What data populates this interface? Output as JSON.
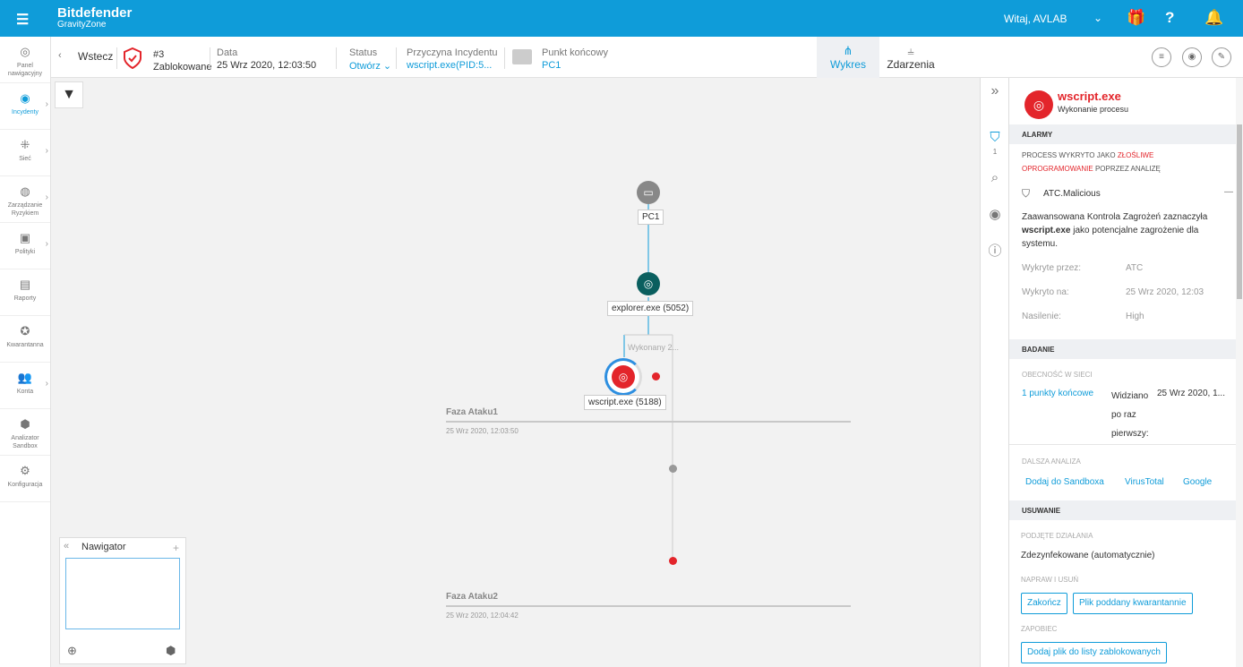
{
  "topbar": {
    "brand": "Bitdefender",
    "product": "GravityZone",
    "greeting": "Witaj, AVLAB"
  },
  "sidebar": [
    {
      "label": "Panel nawigacyjny",
      "icon": "dashboard-icon"
    },
    {
      "label": "Incydenty",
      "icon": "incidents-icon",
      "active": true
    },
    {
      "label": "Sieć",
      "icon": "network-icon"
    },
    {
      "label": "Zarządzanie Ryzykiem",
      "icon": "risk-icon"
    },
    {
      "label": "Polityki",
      "icon": "policy-icon"
    },
    {
      "label": "Raporty",
      "icon": "reports-icon"
    },
    {
      "label": "Kwarantanna",
      "icon": "quarantine-icon"
    },
    {
      "label": "Konta",
      "icon": "accounts-icon"
    },
    {
      "label": "Analizator Sandbox",
      "icon": "sandbox-icon"
    },
    {
      "label": "Konfiguracja",
      "icon": "config-icon"
    }
  ],
  "header": {
    "back": "Wstecz",
    "incident_id": "#3",
    "incident_state": "Zablokowane",
    "date_label": "Data",
    "date_value": "25 Wrz 2020, 12:03:50",
    "status_label": "Status",
    "status_value": "Otwórz",
    "cause_label": "Przyczyna Incydentu",
    "cause_value": "wscript.exe(PID:5...",
    "endpoint_label": "Punkt końcowy",
    "endpoint_value": "PC1",
    "tab_graph": "Wykres",
    "tab_events": "Zdarzenia"
  },
  "graph": {
    "nodes": {
      "pc": "PC1",
      "explorer": "explorer.exe (5052)",
      "wscript": "wscript.exe (5188)"
    },
    "edge_label": "Wykonany 2...",
    "phase1_title": "Faza Ataku1",
    "phase1_date": "25 Wrz 2020, 12:03:50",
    "phase2_title": "Faza Ataku2",
    "phase2_date": "25 Wrz 2020, 12:04:42"
  },
  "navigator": {
    "title": "Nawigator"
  },
  "rightnav": {
    "alarm_count": "1"
  },
  "panel": {
    "title": "wscript.exe",
    "subtitle": "Wykonanie procesu",
    "alarms_header": "ALARMY",
    "alarm_text_1": "PROCESS WYKRYTO JAKO ",
    "alarm_text_red": "ZŁOŚLIWE OPROGRAMOWANIE",
    "alarm_text_2": " POPRZEZ ANALIZĘ",
    "alarm_name": "ATC.Malicious",
    "desc_1": "Zaawansowana Kontrola Zagrożeń zaznaczyła ",
    "desc_bold": "wscript.exe",
    "desc_2": " jako potencjalne zagrożenie dla systemu.",
    "detected_by_label": "Wykryte przez:",
    "detected_by": "ATC",
    "detected_on_label": "Wykryto na:",
    "detected_on": "25 Wrz 2020, 12:03",
    "severity_label": "Nasilenie:",
    "severity": "High",
    "investigate_header": "BADANIE",
    "presence_label": "OBECNOŚĆ W SIECI",
    "endpoints_link": "1 punkty końcowe",
    "first_seen_label": "Widziano po raz pierwszy:",
    "first_seen": "25 Wrz 2020, 1...",
    "further_label": "DALSZA ANALIZA",
    "sandbox_link": "Dodaj do Sandboxa",
    "virustotal_link": "VirusTotal",
    "google_link": "Google",
    "remove_header": "USUWANIE",
    "actions_label": "PODJĘTE DZIAŁANIA",
    "action_value": "Zdezynfekowane (automatycznie)",
    "fix_label": "NAPRAW I USUŃ",
    "btn_terminate": "Zakończ",
    "btn_quarantine": "Plik poddany kwarantannie",
    "prevent_label": "ZAPOBIEC",
    "btn_block": "Dodaj plik do listy zablokowanych"
  }
}
